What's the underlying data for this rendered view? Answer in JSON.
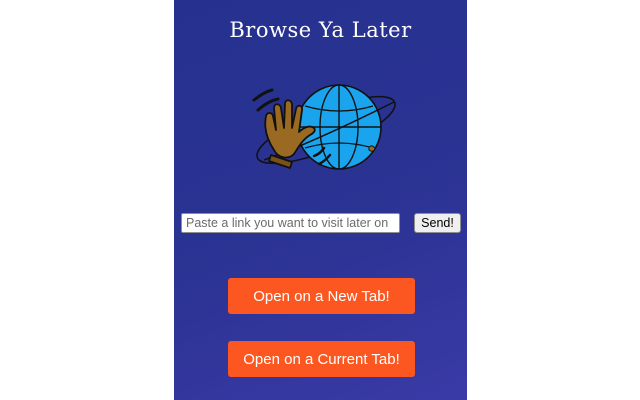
{
  "app": {
    "title": "Browse Ya Later",
    "logo_icon": "waving-hand-globe-icon"
  },
  "link_form": {
    "input_value": "",
    "placeholder": "Paste a link you want to visit later on",
    "send_label": "Send!"
  },
  "actions": {
    "open_new_tab_label": "Open on a New Tab!",
    "open_current_tab_label": "Open on a Current Tab!"
  },
  "colors": {
    "background": "#2b3393",
    "accent_button": "#fc5721",
    "globe_fill": "#1ba4ee",
    "hand_fill": "#9a6a22"
  }
}
